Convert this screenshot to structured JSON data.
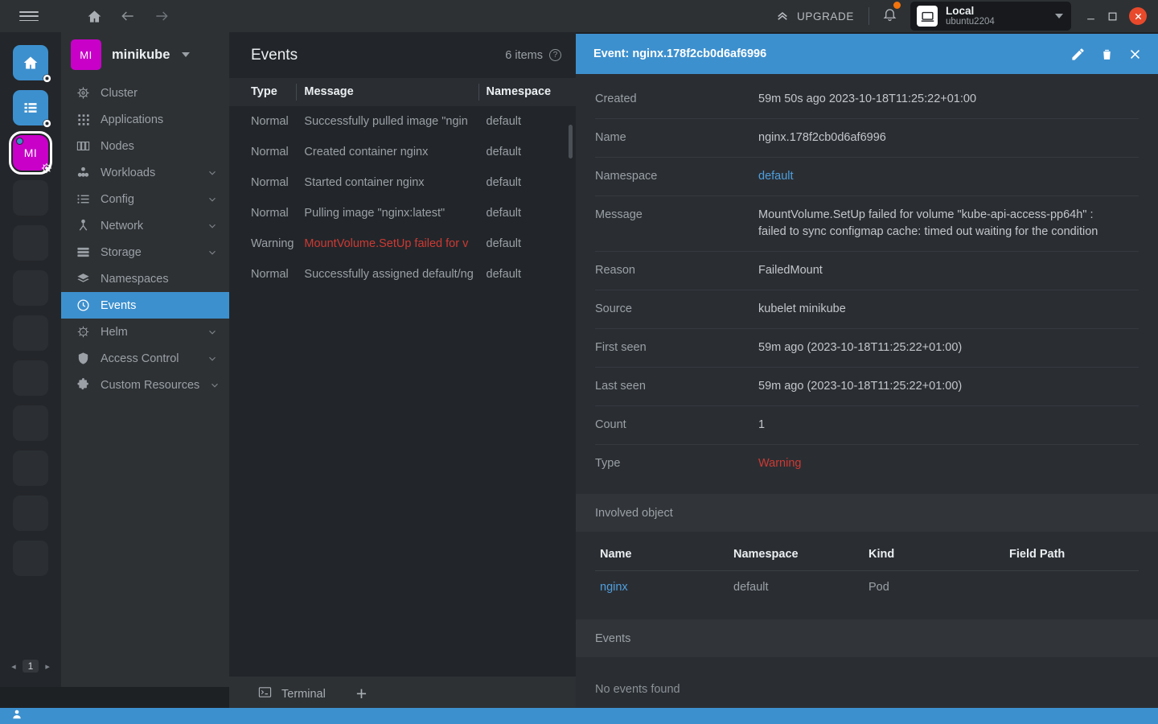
{
  "titlebar": {
    "menu_icon": "hamburger-icon",
    "home_icon": "home-icon",
    "back_icon": "arrow-left-icon",
    "forward_icon": "arrow-right-icon",
    "upgrade_label": "UPGRADE",
    "upgrade_icon": "chevrons-up-icon",
    "notifications_icon": "bell-icon",
    "cluster_pill": {
      "icon": "laptop-icon",
      "title": "Local",
      "subtitle": "ubuntu2204",
      "caret_icon": "chevron-down-icon"
    },
    "minimize_icon": "minimize-icon",
    "maximize_icon": "maximize-icon",
    "close_icon": "close-icon"
  },
  "rail": {
    "items": [
      {
        "name": "home",
        "kind": "blue",
        "icon": "home-icon",
        "badge": "gear-icon",
        "active": false
      },
      {
        "name": "catalog",
        "kind": "blue",
        "icon": "list-icon",
        "badge": "gear-icon",
        "active": false
      },
      {
        "name": "minikube",
        "kind": "magenta",
        "label": "MI",
        "badge": "helm-wheel-icon",
        "active": true
      },
      {
        "name": "slot-4",
        "kind": "empty"
      },
      {
        "name": "slot-5",
        "kind": "empty"
      },
      {
        "name": "slot-6",
        "kind": "empty"
      },
      {
        "name": "slot-7",
        "kind": "empty"
      },
      {
        "name": "slot-8",
        "kind": "empty"
      },
      {
        "name": "slot-9",
        "kind": "empty"
      },
      {
        "name": "slot-10",
        "kind": "empty"
      },
      {
        "name": "slot-11",
        "kind": "empty"
      },
      {
        "name": "slot-12",
        "kind": "empty"
      }
    ],
    "pager": {
      "prev": "◂",
      "page": "1",
      "next": "▸"
    }
  },
  "sidebar": {
    "avatar_label": "MI",
    "cluster_name": "minikube",
    "items": [
      {
        "label": "Cluster",
        "icon": "helm-wheel-icon",
        "expandable": false,
        "selected": false
      },
      {
        "label": "Applications",
        "icon": "grid-apps-icon",
        "expandable": false,
        "selected": false
      },
      {
        "label": "Nodes",
        "icon": "nodes-icon",
        "expandable": false,
        "selected": false
      },
      {
        "label": "Workloads",
        "icon": "workloads-icon",
        "expandable": true,
        "selected": false
      },
      {
        "label": "Config",
        "icon": "config-list-icon",
        "expandable": true,
        "selected": false
      },
      {
        "label": "Network",
        "icon": "network-icon",
        "expandable": true,
        "selected": false
      },
      {
        "label": "Storage",
        "icon": "storage-icon",
        "expandable": true,
        "selected": false
      },
      {
        "label": "Namespaces",
        "icon": "layers-icon",
        "expandable": false,
        "selected": false
      },
      {
        "label": "Events",
        "icon": "clock-icon",
        "expandable": false,
        "selected": true
      },
      {
        "label": "Helm",
        "icon": "helm-icon",
        "expandable": true,
        "selected": false
      },
      {
        "label": "Access Control",
        "icon": "shield-icon",
        "expandable": true,
        "selected": false
      },
      {
        "label": "Custom Resources",
        "icon": "puzzle-icon",
        "expandable": true,
        "selected": false
      }
    ]
  },
  "events_panel": {
    "title": "Events",
    "count_label": "6 items",
    "help_icon": "question-mark-icon",
    "columns": [
      "Type",
      "Message",
      "Namespace"
    ],
    "rows": [
      {
        "type": "Normal",
        "message": "Successfully pulled image \"ngin",
        "namespace": "default",
        "warning": false
      },
      {
        "type": "Normal",
        "message": "Created container nginx",
        "namespace": "default",
        "warning": false
      },
      {
        "type": "Normal",
        "message": "Started container nginx",
        "namespace": "default",
        "warning": false
      },
      {
        "type": "Normal",
        "message": "Pulling image \"nginx:latest\"",
        "namespace": "default",
        "warning": false
      },
      {
        "type": "Warning",
        "message": "MountVolume.SetUp failed for v",
        "namespace": "default",
        "warning": true
      },
      {
        "type": "Normal",
        "message": "Successfully assigned default/nɡ",
        "namespace": "default",
        "warning": false
      }
    ]
  },
  "dock": {
    "terminal_label": "Terminal",
    "terminal_icon": "terminal-icon",
    "add_label": "+"
  },
  "drawer": {
    "title": "Event: nginx.178f2cb0d6af6996",
    "edit_icon": "pencil-icon",
    "delete_icon": "trash-icon",
    "close_icon": "close-icon",
    "fields": [
      {
        "key": "Created",
        "value": "59m 50s ago 2023-10-18T11:25:22+01:00",
        "style": "plain"
      },
      {
        "key": "Name",
        "value": "nginx.178f2cb0d6af6996",
        "style": "plain"
      },
      {
        "key": "Namespace",
        "value": "default",
        "style": "link"
      },
      {
        "key": "Message",
        "value": "MountVolume.SetUp failed for volume \"kube-api-access-pp64h\" : failed to sync configmap cache: timed out waiting for the condition",
        "style": "plain"
      },
      {
        "key": "Reason",
        "value": "FailedMount",
        "style": "plain"
      },
      {
        "key": "Source",
        "value": "kubelet minikube",
        "style": "plain"
      },
      {
        "key": "First seen",
        "value": "59m ago (2023-10-18T11:25:22+01:00)",
        "style": "plain"
      },
      {
        "key": "Last seen",
        "value": "59m ago (2023-10-18T11:25:22+01:00)",
        "style": "plain"
      },
      {
        "key": "Count",
        "value": "1",
        "style": "plain"
      },
      {
        "key": "Type",
        "value": "Warning",
        "style": "warn"
      }
    ],
    "involved_object": {
      "section_title": "Involved object",
      "columns": [
        "Name",
        "Namespace",
        "Kind",
        "Field Path"
      ],
      "rows": [
        {
          "name": "nginx",
          "namespace": "default",
          "kind": "Pod",
          "field_path": ""
        }
      ]
    },
    "events_section": {
      "section_title": "Events",
      "empty_message": "No events found"
    }
  },
  "statusbar": {
    "user_icon": "user-icon"
  },
  "colors": {
    "accent_blue": "#3d90ce",
    "magenta": "#c800c8",
    "warning_red": "#ce3933",
    "link_blue": "#4f9fdd",
    "close_red": "#e8492b",
    "notify_orange": "#f2740d"
  }
}
